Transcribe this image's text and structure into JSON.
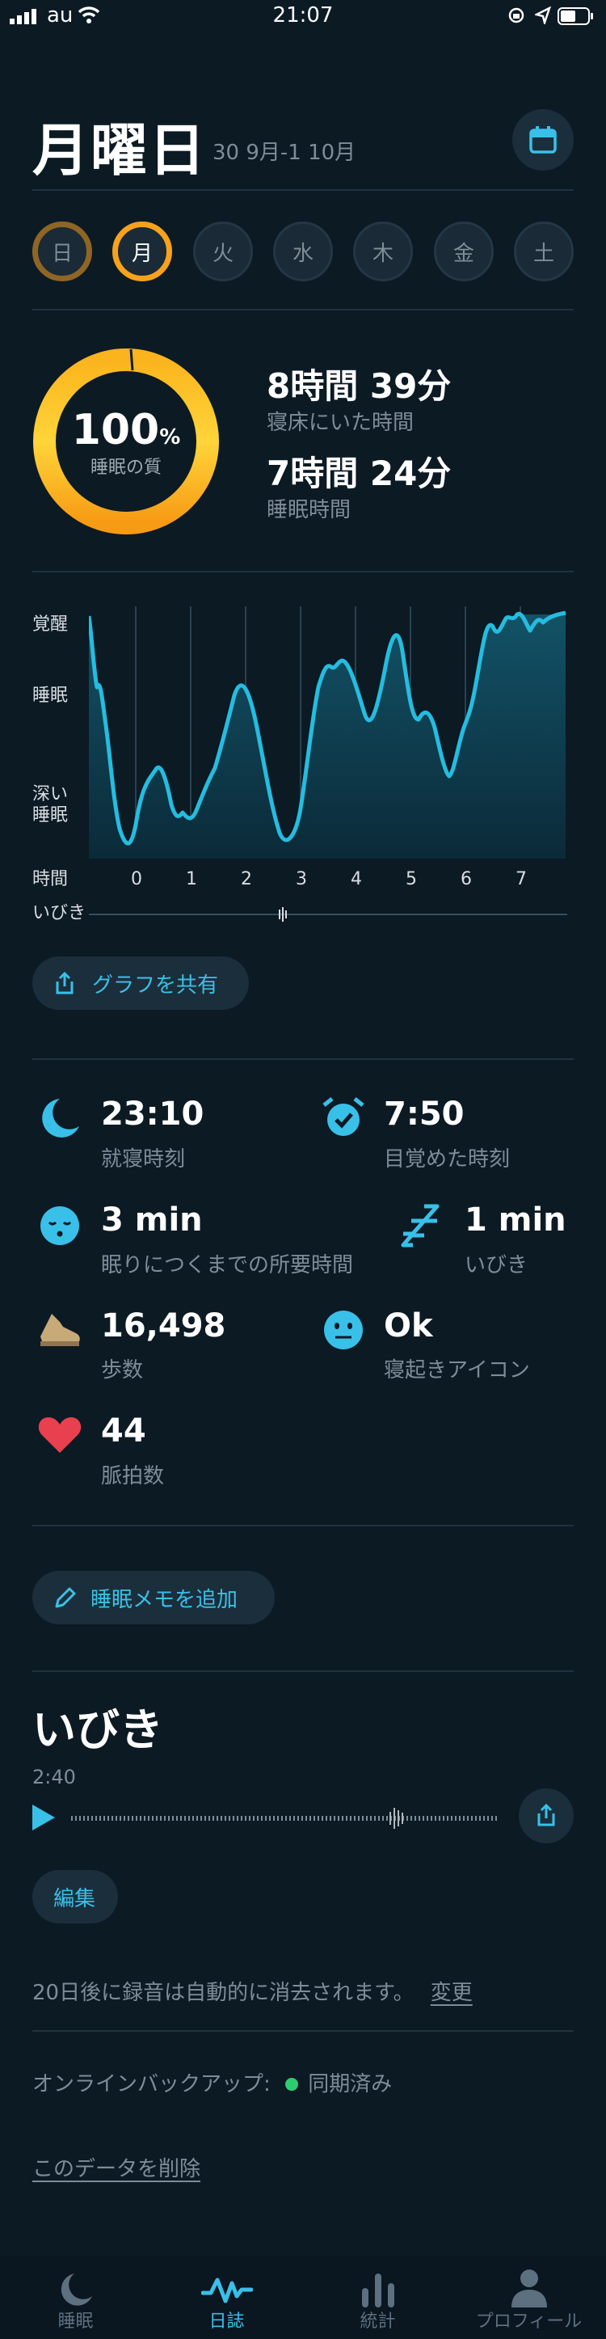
{
  "status_bar": {
    "carrier": "au",
    "time": "21:07"
  },
  "header": {
    "title": "月曜日",
    "subtitle": "30 9月-1 10月"
  },
  "days": [
    "日",
    "月",
    "火",
    "水",
    "木",
    "金",
    "土"
  ],
  "summary": {
    "quality_value": "100",
    "quality_unit": "%",
    "quality_label": "睡眠の質",
    "in_bed_value": "8時間 39分",
    "in_bed_label": "寝床にいた時間",
    "asleep_value": "7時間 24分",
    "asleep_label": "睡眠時間"
  },
  "graph": {
    "y_labels": [
      "覚醒",
      "睡眠",
      "深い\n睡眠"
    ],
    "x_label": "時間",
    "snore_label": "いびき",
    "x_ticks": [
      "0",
      "1",
      "2",
      "3",
      "4",
      "5",
      "6",
      "7"
    ]
  },
  "share_button": "グラフを共有",
  "metrics": {
    "bedtime": {
      "value": "23:10",
      "label": "就寝時刻"
    },
    "wakeup": {
      "value": "7:50",
      "label": "目覚めた時刻"
    },
    "fall_asleep": {
      "value": "3 min",
      "label": "眠りにつくまでの所要時間"
    },
    "snoring": {
      "value": "1 min",
      "label": "いびき"
    },
    "steps": {
      "value": "16,498",
      "label": "歩数"
    },
    "mood": {
      "value": "Ok",
      "label": "寝起きアイコン"
    },
    "heart_rate": {
      "value": "44",
      "label": "脈拍数"
    }
  },
  "add_note_button": "睡眠メモを追加",
  "snore_section": {
    "title": "いびき",
    "duration": "2:40",
    "edit_button": "編集",
    "auto_delete_text": "20日後に録音は自動的に消去されます。",
    "change_link": "変更"
  },
  "backup": {
    "label": "オンラインバックアップ:",
    "status": "同期済み"
  },
  "delete_link": "このデータを削除",
  "tabs": [
    "睡眠",
    "日誌",
    "統計",
    "プロフィール"
  ],
  "colors": {
    "background": "#0c1a24",
    "accent": "#39c0e8",
    "ring_orange": "#f7a21b",
    "heart": "#e8404f",
    "sync_dot": "#2ecc71"
  }
}
